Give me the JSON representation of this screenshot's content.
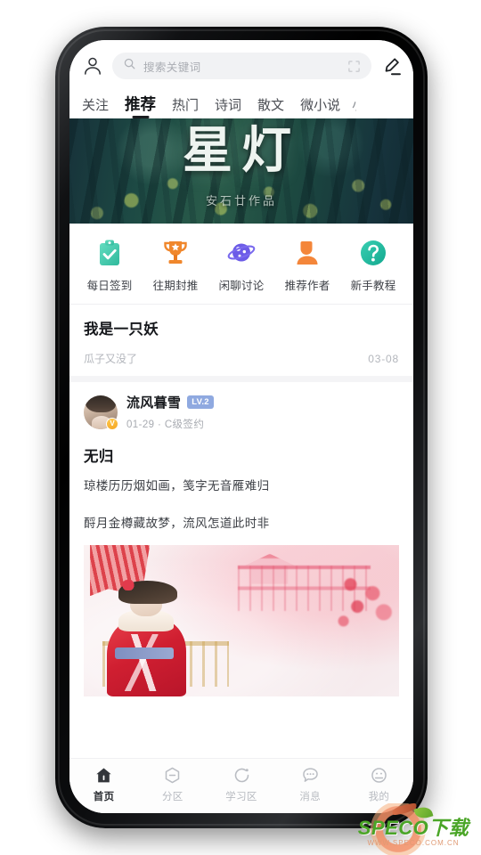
{
  "topbar": {
    "profile_icon": "person-icon",
    "search_placeholder": "搜索关键词",
    "search_value": "",
    "search_icon": "search-icon",
    "scan_icon": "scan-icon",
    "edit_icon": "pencil-edit-icon"
  },
  "tabs": {
    "items": [
      {
        "label": "关注",
        "active": false
      },
      {
        "label": "推荐",
        "active": true
      },
      {
        "label": "热门",
        "active": false
      },
      {
        "label": "诗词",
        "active": false
      },
      {
        "label": "散文",
        "active": false
      },
      {
        "label": "微小说",
        "active": false
      },
      {
        "label": "小",
        "active": false
      }
    ],
    "more_icon": "hamburger-menu-icon"
  },
  "banner": {
    "title": "星灯",
    "subtitle": "安石廿作品"
  },
  "quick_actions": [
    {
      "label": "每日签到",
      "icon": "clipboard-check-icon",
      "color": "#4ecfb0"
    },
    {
      "label": "往期封推",
      "icon": "trophy-icon",
      "color": "#f08a2e"
    },
    {
      "label": "闲聊讨论",
      "icon": "planet-icon",
      "color": "#6c5ce7"
    },
    {
      "label": "推荐作者",
      "icon": "person-filled-icon",
      "color": "#f4863a"
    },
    {
      "label": "新手教程",
      "icon": "question-circle-icon",
      "color": "#24bca0"
    }
  ],
  "feed": {
    "post_a": {
      "title": "我是一只妖",
      "author": "瓜子又没了",
      "date": "03-08"
    },
    "post_b": {
      "author": "流风暮雪",
      "level_badge": "LV.2",
      "verified_badge": "V",
      "date": "01-29",
      "separator": "·",
      "signing": "C级签约",
      "meta_line": "01-29 · C级签约",
      "title": "无归",
      "paragraph1": "琼楼历历烟如画，笺字无音雁难归",
      "paragraph2": "酹月金樽藏故梦，流风怎道此时非",
      "image_alt": "红衣女子与亭台桃花插画"
    }
  },
  "bottom_nav": [
    {
      "label": "首页",
      "icon": "home-icon",
      "active": true
    },
    {
      "label": "分区",
      "icon": "hexagon-minus-icon",
      "active": false
    },
    {
      "label": "学习区",
      "icon": "circle-arrow-icon",
      "active": false
    },
    {
      "label": "消息",
      "icon": "chat-bubble-icon",
      "active": false
    },
    {
      "label": "我的",
      "icon": "face-icon",
      "active": false
    }
  ],
  "watermark": {
    "text": "SPECO下载",
    "url": "WWW.SPECO.COM.CN"
  }
}
